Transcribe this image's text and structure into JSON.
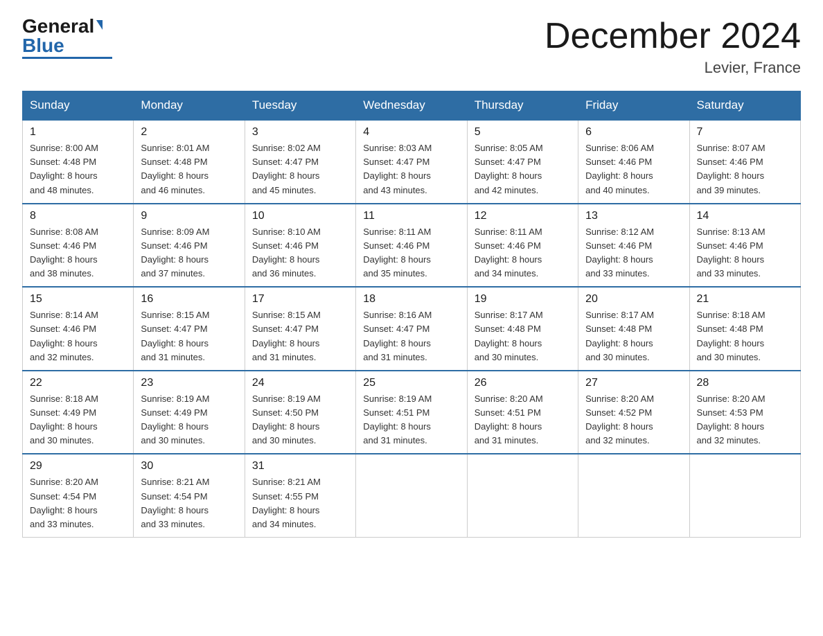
{
  "logo": {
    "general": "General",
    "arrow": "▶",
    "blue": "Blue"
  },
  "title": "December 2024",
  "subtitle": "Levier, France",
  "days_of_week": [
    "Sunday",
    "Monday",
    "Tuesday",
    "Wednesday",
    "Thursday",
    "Friday",
    "Saturday"
  ],
  "weeks": [
    [
      {
        "num": "1",
        "sunrise": "8:00 AM",
        "sunset": "4:48 PM",
        "daylight": "8 hours and 48 minutes."
      },
      {
        "num": "2",
        "sunrise": "8:01 AM",
        "sunset": "4:48 PM",
        "daylight": "8 hours and 46 minutes."
      },
      {
        "num": "3",
        "sunrise": "8:02 AM",
        "sunset": "4:47 PM",
        "daylight": "8 hours and 45 minutes."
      },
      {
        "num": "4",
        "sunrise": "8:03 AM",
        "sunset": "4:47 PM",
        "daylight": "8 hours and 43 minutes."
      },
      {
        "num": "5",
        "sunrise": "8:05 AM",
        "sunset": "4:47 PM",
        "daylight": "8 hours and 42 minutes."
      },
      {
        "num": "6",
        "sunrise": "8:06 AM",
        "sunset": "4:46 PM",
        "daylight": "8 hours and 40 minutes."
      },
      {
        "num": "7",
        "sunrise": "8:07 AM",
        "sunset": "4:46 PM",
        "daylight": "8 hours and 39 minutes."
      }
    ],
    [
      {
        "num": "8",
        "sunrise": "8:08 AM",
        "sunset": "4:46 PM",
        "daylight": "8 hours and 38 minutes."
      },
      {
        "num": "9",
        "sunrise": "8:09 AM",
        "sunset": "4:46 PM",
        "daylight": "8 hours and 37 minutes."
      },
      {
        "num": "10",
        "sunrise": "8:10 AM",
        "sunset": "4:46 PM",
        "daylight": "8 hours and 36 minutes."
      },
      {
        "num": "11",
        "sunrise": "8:11 AM",
        "sunset": "4:46 PM",
        "daylight": "8 hours and 35 minutes."
      },
      {
        "num": "12",
        "sunrise": "8:11 AM",
        "sunset": "4:46 PM",
        "daylight": "8 hours and 34 minutes."
      },
      {
        "num": "13",
        "sunrise": "8:12 AM",
        "sunset": "4:46 PM",
        "daylight": "8 hours and 33 minutes."
      },
      {
        "num": "14",
        "sunrise": "8:13 AM",
        "sunset": "4:46 PM",
        "daylight": "8 hours and 33 minutes."
      }
    ],
    [
      {
        "num": "15",
        "sunrise": "8:14 AM",
        "sunset": "4:46 PM",
        "daylight": "8 hours and 32 minutes."
      },
      {
        "num": "16",
        "sunrise": "8:15 AM",
        "sunset": "4:47 PM",
        "daylight": "8 hours and 31 minutes."
      },
      {
        "num": "17",
        "sunrise": "8:15 AM",
        "sunset": "4:47 PM",
        "daylight": "8 hours and 31 minutes."
      },
      {
        "num": "18",
        "sunrise": "8:16 AM",
        "sunset": "4:47 PM",
        "daylight": "8 hours and 31 minutes."
      },
      {
        "num": "19",
        "sunrise": "8:17 AM",
        "sunset": "4:48 PM",
        "daylight": "8 hours and 30 minutes."
      },
      {
        "num": "20",
        "sunrise": "8:17 AM",
        "sunset": "4:48 PM",
        "daylight": "8 hours and 30 minutes."
      },
      {
        "num": "21",
        "sunrise": "8:18 AM",
        "sunset": "4:48 PM",
        "daylight": "8 hours and 30 minutes."
      }
    ],
    [
      {
        "num": "22",
        "sunrise": "8:18 AM",
        "sunset": "4:49 PM",
        "daylight": "8 hours and 30 minutes."
      },
      {
        "num": "23",
        "sunrise": "8:19 AM",
        "sunset": "4:49 PM",
        "daylight": "8 hours and 30 minutes."
      },
      {
        "num": "24",
        "sunrise": "8:19 AM",
        "sunset": "4:50 PM",
        "daylight": "8 hours and 30 minutes."
      },
      {
        "num": "25",
        "sunrise": "8:19 AM",
        "sunset": "4:51 PM",
        "daylight": "8 hours and 31 minutes."
      },
      {
        "num": "26",
        "sunrise": "8:20 AM",
        "sunset": "4:51 PM",
        "daylight": "8 hours and 31 minutes."
      },
      {
        "num": "27",
        "sunrise": "8:20 AM",
        "sunset": "4:52 PM",
        "daylight": "8 hours and 32 minutes."
      },
      {
        "num": "28",
        "sunrise": "8:20 AM",
        "sunset": "4:53 PM",
        "daylight": "8 hours and 32 minutes."
      }
    ],
    [
      {
        "num": "29",
        "sunrise": "8:20 AM",
        "sunset": "4:54 PM",
        "daylight": "8 hours and 33 minutes."
      },
      {
        "num": "30",
        "sunrise": "8:21 AM",
        "sunset": "4:54 PM",
        "daylight": "8 hours and 33 minutes."
      },
      {
        "num": "31",
        "sunrise": "8:21 AM",
        "sunset": "4:55 PM",
        "daylight": "8 hours and 34 minutes."
      },
      null,
      null,
      null,
      null
    ]
  ],
  "labels": {
    "sunrise": "Sunrise:",
    "sunset": "Sunset:",
    "daylight": "Daylight:"
  },
  "colors": {
    "header_bg": "#2e6da4",
    "header_text": "#ffffff",
    "border": "#cccccc"
  }
}
